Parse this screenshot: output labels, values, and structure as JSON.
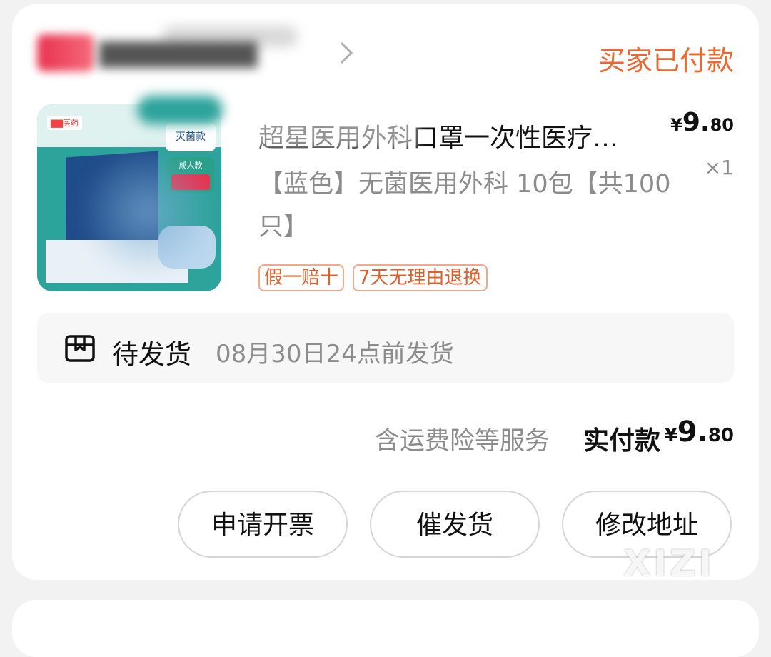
{
  "order": {
    "status": "买家已付款",
    "store_chevron_icon": "chevron-right-icon"
  },
  "product": {
    "title": "超星医用外科口罩一次性医疗…",
    "spec": "【蓝色】无菌医用外科 10包【共100只】",
    "price_symbol": "¥",
    "price_int": "9.",
    "price_dec": "80",
    "quantity": "×1",
    "tags": [
      "假一赔十",
      "7天无理由退换"
    ]
  },
  "shipping": {
    "icon": "package-icon",
    "status": "待发货",
    "deadline": "08月30日24点前发货"
  },
  "payment": {
    "note": "含运费险等服务",
    "label": "实付款",
    "symbol": "¥",
    "amount_int": "9.",
    "amount_dec": "80"
  },
  "actions": {
    "invoice": "申请开票",
    "urge": "催发货",
    "address": "修改地址"
  },
  "watermark": "XIZI",
  "colors": {
    "status_orange": "#f0662e",
    "tag_border": "#f3a988",
    "tag_text": "#e35e2a"
  }
}
